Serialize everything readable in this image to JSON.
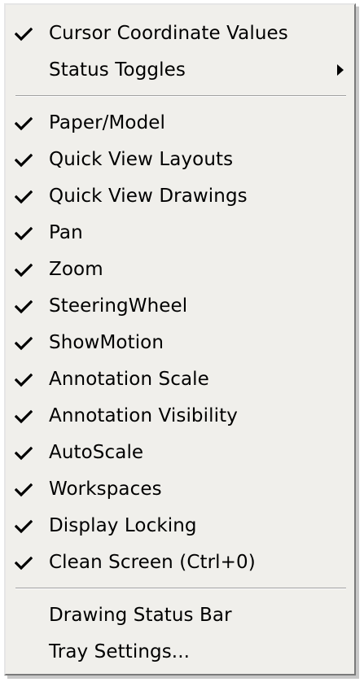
{
  "menu": {
    "top_items": [
      {
        "label": "Cursor Coordinate Values",
        "checked": true,
        "icon": "checkmark-icon"
      },
      {
        "label": "Status Toggles",
        "checked": false,
        "submenu": true,
        "icon": "submenu-arrow-icon"
      }
    ],
    "toggle_items": [
      {
        "label": "Paper/Model",
        "checked": true
      },
      {
        "label": "Quick View Layouts",
        "checked": true
      },
      {
        "label": "Quick View Drawings",
        "checked": true
      },
      {
        "label": "Pan",
        "checked": true
      },
      {
        "label": "Zoom",
        "checked": true
      },
      {
        "label": "SteeringWheel",
        "checked": true
      },
      {
        "label": "ShowMotion",
        "checked": true
      },
      {
        "label": "Annotation Scale",
        "checked": true
      },
      {
        "label": "Annotation Visibility",
        "checked": true
      },
      {
        "label": "AutoScale",
        "checked": true
      },
      {
        "label": "Workspaces",
        "checked": true
      },
      {
        "label": "Display Locking",
        "checked": true
      },
      {
        "label": "Clean Screen (Ctrl+0)",
        "checked": true
      }
    ],
    "bottom_items": [
      {
        "label": "Drawing Status Bar",
        "checked": false
      },
      {
        "label": "Tray Settings...",
        "checked": false
      }
    ]
  },
  "colors": {
    "menu_background": "#f0efeb",
    "text": "#000000",
    "separator": "#a0a0a0"
  }
}
